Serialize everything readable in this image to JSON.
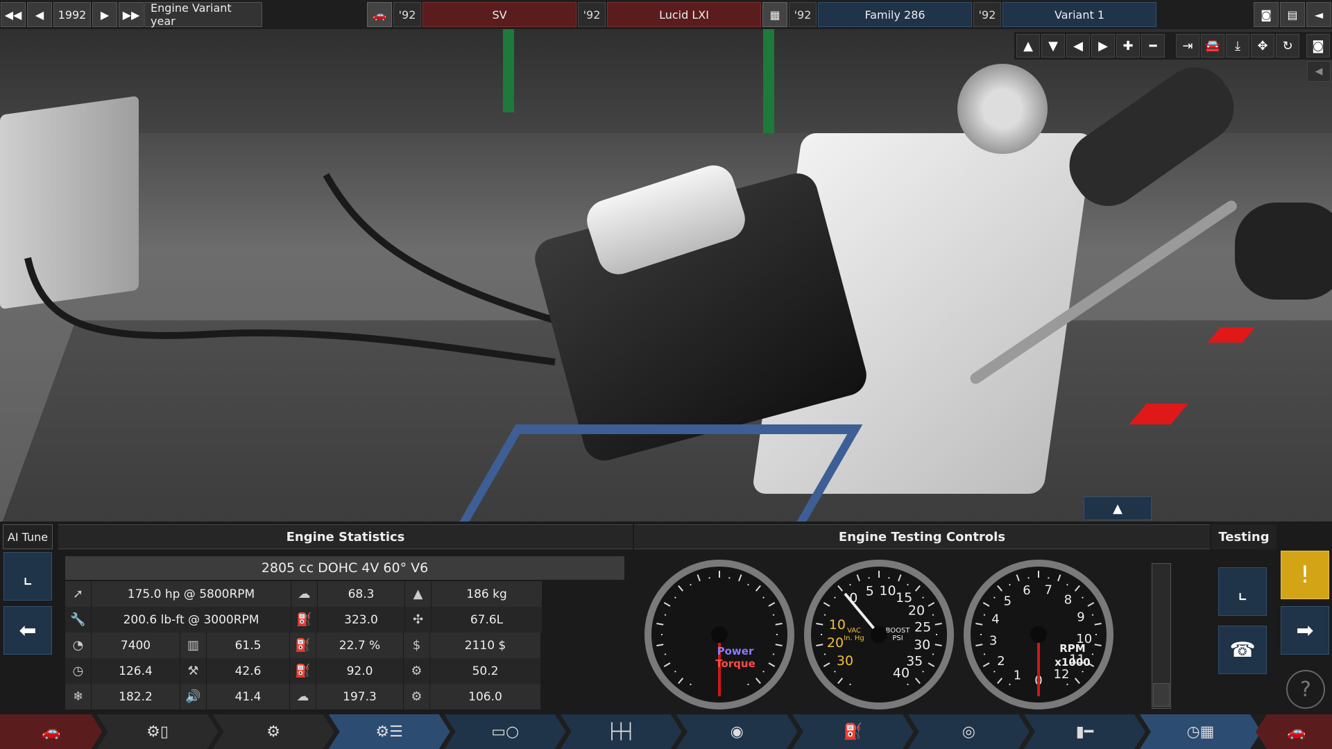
{
  "topbar": {
    "year": "1992",
    "year_label": "Engine Variant year",
    "car_year": "'92",
    "car_model": "SV",
    "trim_year": "'92",
    "trim_name": "Lucid LXI",
    "family_year": "'92",
    "family_name": "Family 286",
    "variant_year": "'92",
    "variant_name": "Variant 1"
  },
  "ai_tune": {
    "title": "AI Tune"
  },
  "engine_stats": {
    "title": "Engine Statistics",
    "description": "2805 cc DOHC 4V 60° V6",
    "rows": [
      {
        "a_icon": "power-icon",
        "a": "175.0 hp @ 5800RPM",
        "b_icon": "emissions-icon",
        "b": "68.3",
        "c_icon": "weight-icon",
        "c": "186 kg"
      },
      {
        "a_icon": "torque-icon",
        "a": "200.6 lb-ft @ 3000RPM",
        "b_icon": "fuel-economy-icon",
        "b": "323.0",
        "c_icon": "size-icon",
        "c": "67.6L"
      },
      {
        "a_icon": "rpm-icon",
        "a": "7400",
        "b_icon": "smoothness-icon",
        "b": "61.5",
        "c_icon": "cost-icon",
        "c": "2110 $"
      },
      {
        "a_icon": "responsiveness-icon",
        "a": "126.4",
        "b_icon": "reliability-icon",
        "b": "42.6",
        "c_icon": "service-icon",
        "c": "50.2"
      },
      {
        "a_icon": "cooling-icon",
        "a": "182.2",
        "b_icon": "noise-icon",
        "b": "41.4",
        "c_icon": "engineering-time-icon",
        "c": "106.0"
      }
    ],
    "efficiency_row": {
      "b2": "22.7 %",
      "b3": "92.0",
      "b4": "197.3"
    }
  },
  "engine_testing": {
    "title": "Engine Testing Controls",
    "power_label": "Power",
    "torque_label": "Torque",
    "boost_unit_vac": "VAC",
    "boost_unit_inhg": "In. Hg",
    "boost_unit_boost": "BOOST",
    "boost_unit_psi": "PSI",
    "rpm_label": "RPM",
    "rpm_mult": "x1000",
    "boost_ticks": [
      "0",
      "5",
      "10",
      "15",
      "20",
      "25",
      "30",
      "35",
      "40"
    ],
    "vac_ticks": [
      "10",
      "20",
      "30"
    ],
    "rpm_ticks": [
      "0",
      "1",
      "2",
      "3",
      "4",
      "5",
      "6",
      "7",
      "8",
      "9",
      "10",
      "11",
      "12"
    ]
  },
  "testing": {
    "title": "Testing",
    "help": "?"
  },
  "colors": {
    "red_panel": "#5a1c1c",
    "blue_panel": "#1f3349",
    "warn": "#d4a417"
  }
}
